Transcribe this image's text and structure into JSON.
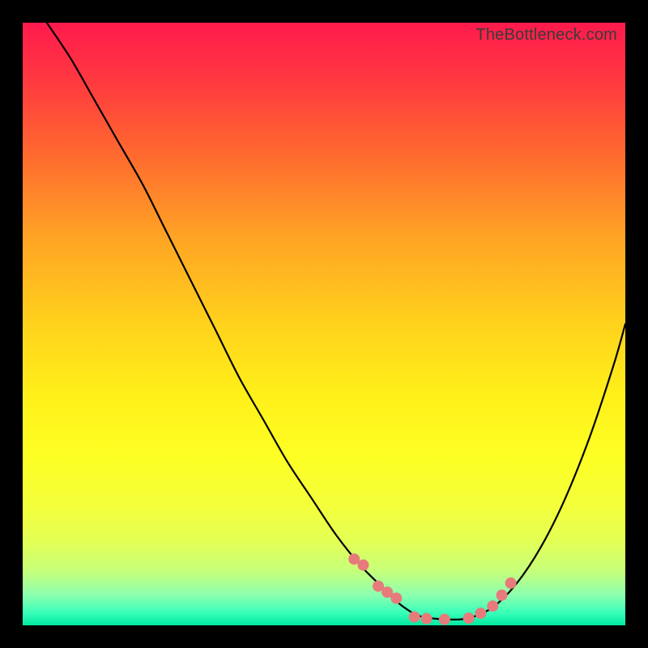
{
  "watermark": "TheBottleneck.com",
  "chart_data": {
    "type": "line",
    "title": "",
    "xlabel": "",
    "ylabel": "",
    "xlim": [
      0,
      100
    ],
    "ylim": [
      0,
      100
    ],
    "series": [
      {
        "name": "bottleneck-curve",
        "x": [
          4,
          8,
          12,
          16,
          20,
          24,
          28,
          32,
          36,
          40,
          44,
          48,
          52,
          56,
          60,
          62,
          64,
          66,
          70,
          74,
          78,
          82,
          86,
          90,
          94,
          98,
          100
        ],
        "y": [
          100,
          94,
          87,
          80,
          73,
          65,
          57,
          49,
          41,
          34,
          27,
          21,
          15,
          10,
          6,
          4,
          2.5,
          1.5,
          1,
          1.2,
          3,
          7,
          13,
          21,
          31,
          43,
          50
        ]
      }
    ],
    "markers": {
      "name": "highlight-points",
      "x": [
        55,
        56.5,
        59,
        60.5,
        62,
        65,
        67,
        70,
        74,
        76,
        78,
        79.5,
        81
      ],
      "y": [
        11,
        10,
        6.5,
        5.5,
        4.5,
        1.4,
        1.1,
        1,
        1.2,
        2,
        3.2,
        5,
        7
      ]
    },
    "colors": {
      "curve": "#000000",
      "markers": "#e77b7b",
      "gradient_top": "#ff1a4d",
      "gradient_bottom": "#00e8a0"
    }
  }
}
